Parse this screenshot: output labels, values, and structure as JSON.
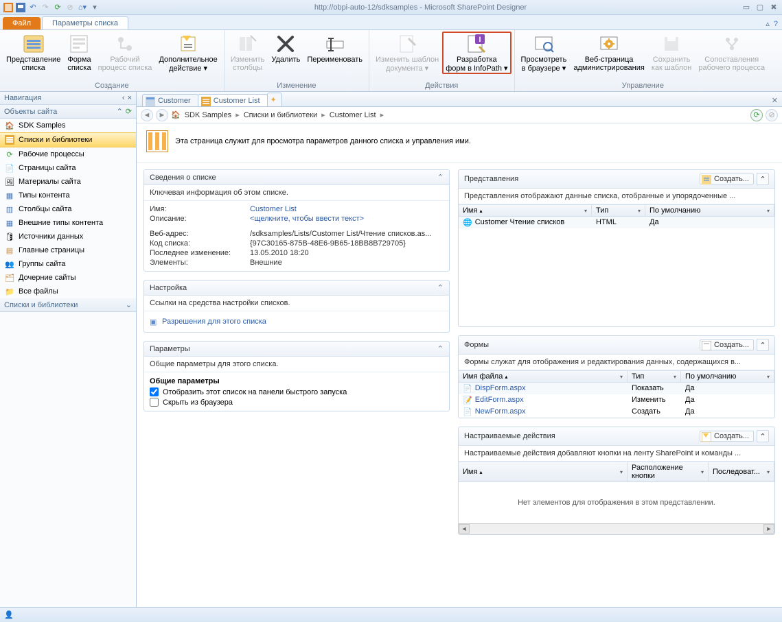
{
  "window": {
    "title": "http://obpi-auto-12/sdksamples - Microsoft SharePoint Designer"
  },
  "tabs": {
    "file": "Файл",
    "active": "Параметры списка"
  },
  "ribbon": {
    "groups": {
      "create": {
        "label": "Создание",
        "buttons": {
          "list_view": "Представление\nсписка",
          "list_form": "Форма\nсписка",
          "workflow": "Рабочий\nпроцесс списка",
          "addon": "Дополнительное\nдействие ▾"
        }
      },
      "edit": {
        "label": "Изменение",
        "buttons": {
          "edit_cols": "Изменить\nстолбцы",
          "delete": "Удалить",
          "rename": "Переименовать"
        }
      },
      "actions": {
        "label": "Действия",
        "buttons": {
          "edit_tmpl": "Изменить шаблон\nдокумента ▾",
          "infopath": "Разработка\nформ в InfoPath ▾"
        }
      },
      "manage": {
        "label": "Управление",
        "buttons": {
          "preview": "Просмотреть\nв браузере ▾",
          "admin": "Веб-страница\nадминистрирования",
          "save_tmpl": "Сохранить\nкак шаблон",
          "wf_map": "Сопоставления\nрабочего процесса"
        }
      }
    }
  },
  "nav": {
    "title": "Навигация",
    "objects_title": "Объекты сайта",
    "lists_title": "Списки и библиотеки",
    "items": [
      "SDK Samples",
      "Списки и библиотеки",
      "Рабочие процессы",
      "Страницы сайта",
      "Материалы сайта",
      "Типы контента",
      "Столбцы сайта",
      "Внешние типы контента",
      "Источники данных",
      "Главные страницы",
      "Группы сайта",
      "Дочерние сайты",
      "Все файлы"
    ]
  },
  "doctabs": {
    "tab1": "Customer",
    "tab2": "Customer List"
  },
  "breadcrumb": {
    "seg1": "SDK Samples",
    "seg2": "Списки и библиотеки",
    "seg3": "Customer List"
  },
  "description": "Эта страница служит для просмотра параметров данного списка и управления ими.",
  "panel_info": {
    "title": "Сведения о списке",
    "sub": "Ключевая информация об этом списке.",
    "rows": {
      "name": {
        "k": "Имя:",
        "v": "Customer List"
      },
      "desc": {
        "k": "Описание:",
        "v": "<щелкните, чтобы ввести текст>"
      },
      "url": {
        "k": "Веб-адрес:",
        "v": "/sdksamples/Lists/Customer List/Чтение списков.as..."
      },
      "code": {
        "k": "Код списка:",
        "v": "{97C30165-875B-48E6-9B65-18BB8B729705}"
      },
      "mod": {
        "k": "Последнее изменение:",
        "v": "13.05.2010 18:20"
      },
      "elems": {
        "k": "Элементы:",
        "v": "Внешние"
      }
    }
  },
  "panel_settings": {
    "title": "Настройка",
    "sub": "Ссылки на средства настройки списков.",
    "link": "Разрешения для этого списка"
  },
  "panel_params": {
    "title": "Параметры",
    "sub": "Общие параметры для этого списка.",
    "heading": "Общие параметры",
    "opt1": "Отобразить этот список на панели быстрого запуска",
    "opt2": "Скрыть из браузера"
  },
  "panel_views": {
    "title": "Представления",
    "action": "Создать...",
    "sub": "Представления отображают данные списка, отобранные и упорядоченные ...",
    "cols": {
      "name": "Имя",
      "type": "Тип",
      "default": "По умолчанию"
    },
    "row": {
      "name": "Customer Чтение списков",
      "type": "HTML",
      "default": "Да"
    }
  },
  "panel_forms": {
    "title": "Формы",
    "action": "Создать...",
    "sub": "Формы служат для отображения и редактирования данных, содержащихся в...",
    "cols": {
      "name": "Имя файла",
      "type": "Тип",
      "default": "По умолчанию"
    },
    "rows": [
      {
        "name": "DispForm.aspx",
        "type": "Показать",
        "default": "Да"
      },
      {
        "name": "EditForm.aspx",
        "type": "Изменить",
        "default": "Да"
      },
      {
        "name": "NewForm.aspx",
        "type": "Создать",
        "default": "Да"
      }
    ]
  },
  "panel_actions": {
    "title": "Настраиваемые действия",
    "action": "Создать...",
    "sub": "Настраиваемые действия добавляют кнопки на ленту SharePoint и команды ...",
    "cols": {
      "name": "Имя",
      "loc": "Расположение кнопки",
      "seq": "Последоват..."
    },
    "empty": "Нет элементов для отображения в этом представлении."
  }
}
